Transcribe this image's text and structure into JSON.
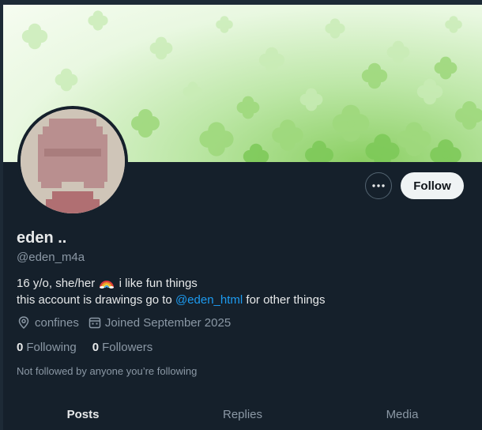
{
  "profile": {
    "display_name": "eden ..",
    "handle": "@eden_m4a",
    "bio_line1_start": "16 y/o, she/her",
    "bio_line1_end": "i like fun things",
    "bio_line2_start": "this account is drawings go to",
    "bio_mention": "@eden_html",
    "bio_line2_end": "for other things",
    "location": "confines",
    "joined": "Joined September 2025",
    "following_count": "0",
    "following_label": "Following",
    "followers_count": "0",
    "followers_label": "Followers",
    "not_followed_text": "Not followed by anyone you’re following"
  },
  "actions": {
    "follow_label": "Follow",
    "more_icon": "more-icon"
  },
  "tabs": [
    {
      "label": "Posts",
      "active": true
    },
    {
      "label": "Replies",
      "active": false
    },
    {
      "label": "Media",
      "active": false
    }
  ],
  "colors": {
    "background": "#15202b",
    "link": "#1d9bf0",
    "secondary_text": "#8b98a5",
    "follow_button_bg": "#eff3f4"
  }
}
